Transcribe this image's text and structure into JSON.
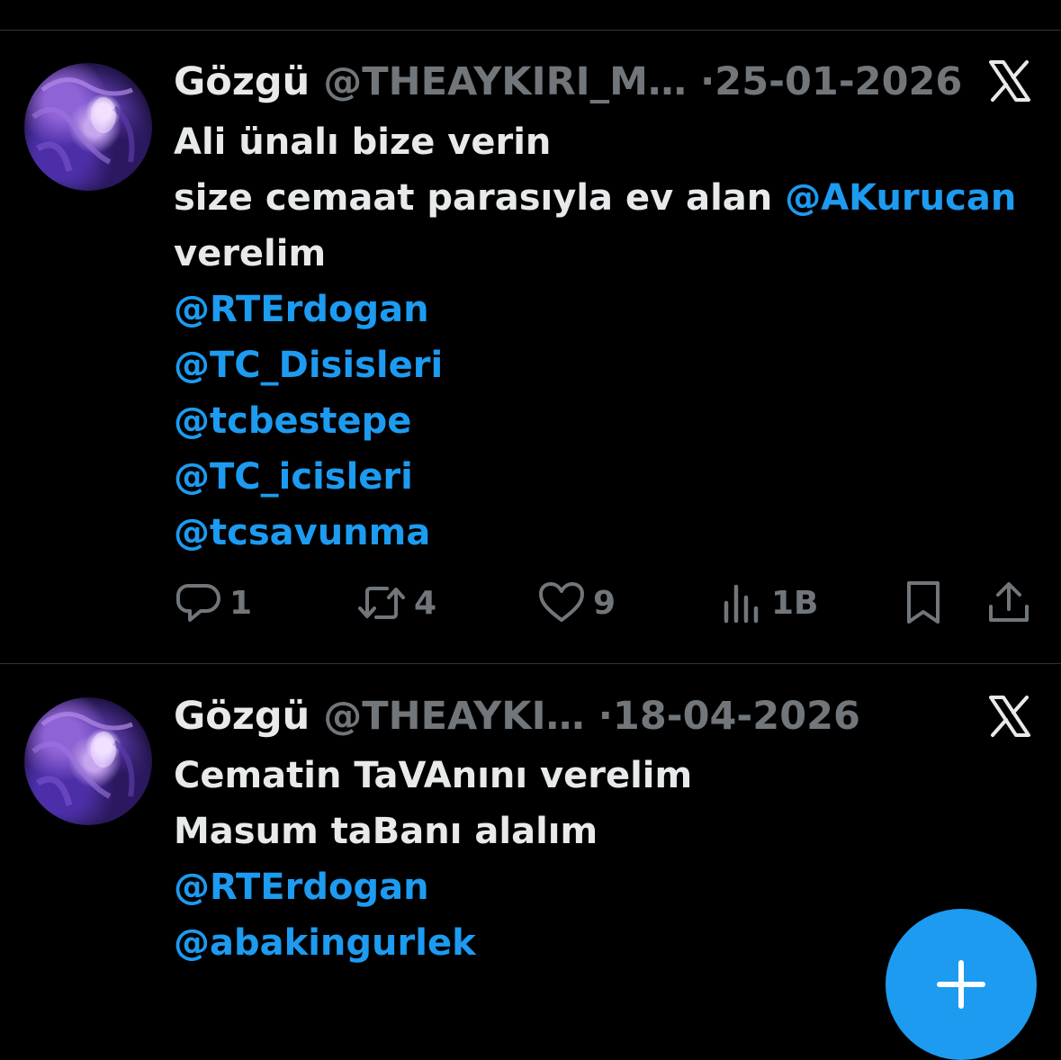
{
  "tweets": [
    {
      "display_name": "Gözgü",
      "handle": "@THEAYKIRI_M…",
      "separator": "·",
      "date": "25-01-2026",
      "lines": [
        [
          {
            "text": "Ali ünalı bize verin",
            "type": "plain"
          }
        ],
        [
          {
            "text": "size cemaat parasıyla ev alan ",
            "type": "plain"
          },
          {
            "text": "@AKurucan",
            "type": "mention"
          }
        ],
        [
          {
            "text": "verelim",
            "type": "plain"
          }
        ],
        [
          {
            "text": "@RTErdogan",
            "type": "mention"
          }
        ],
        [
          {
            "text": "@TC_Disisleri",
            "type": "mention"
          }
        ],
        [
          {
            "text": "@tcbestepe",
            "type": "mention"
          }
        ],
        [
          {
            "text": "@TC_icisleri",
            "type": "mention"
          }
        ],
        [
          {
            "text": "@tcsavunma",
            "type": "mention"
          }
        ]
      ],
      "actions": {
        "replies": "1",
        "reposts": "4",
        "likes": "9",
        "views": "1B"
      }
    },
    {
      "display_name": "Gözgü",
      "handle": "@THEAYKI…",
      "separator": "·",
      "date": "18-04-2026",
      "lines": [
        [
          {
            "text": "Cematin TaVAnını verelim",
            "type": "plain"
          }
        ],
        [
          {
            "text": "Masum taBanı alalım",
            "type": "plain"
          }
        ],
        [
          {
            "text": "@RTErdogan",
            "type": "mention"
          }
        ],
        [
          {
            "text": "@abakingurlek",
            "type": "mention"
          }
        ]
      ]
    }
  ],
  "icons": {
    "platform": "x-logo-icon",
    "reply": "reply-icon",
    "repost": "repost-icon",
    "like": "heart-icon",
    "views": "views-icon",
    "bookmark": "bookmark-icon",
    "share": "share-icon",
    "compose": "plus-icon"
  },
  "colors": {
    "background": "#000000",
    "text": "#e7e9ea",
    "secondary": "#71767b",
    "mention": "#1d9bf0",
    "divider": "#2f3336",
    "fab": "#1d9bf0"
  }
}
